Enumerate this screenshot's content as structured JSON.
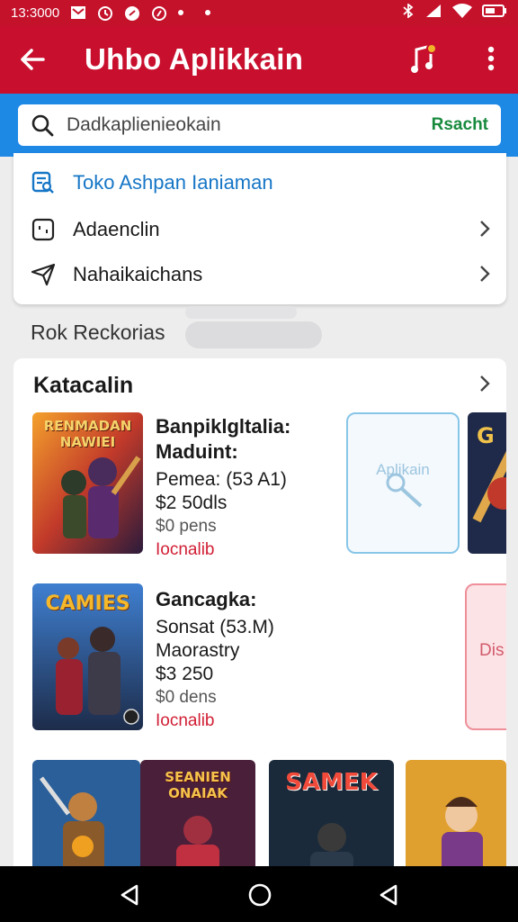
{
  "status_bar": {
    "time": "13:3000",
    "icons": [
      "mail-icon",
      "clock-icon",
      "message-icon",
      "data-icon",
      "dot-icon",
      "bluetooth-icon",
      "signal-icon",
      "wifi-icon",
      "battery-icon"
    ]
  },
  "app_bar": {
    "title": "Uhbo Aplikkain",
    "icons": [
      "back-arrow-icon",
      "music-note-icon",
      "more-vert-icon"
    ],
    "accent": "#c8102e"
  },
  "search": {
    "placeholder": "Dadkaplienieokain",
    "action_label": "Rsacht",
    "band_color": "#1e88e5"
  },
  "menu": {
    "items": [
      {
        "label": "Toko Ashpan Ianiaman",
        "icon": "store-search-icon"
      },
      {
        "label": "Adaencl­in",
        "icon": "square-frame-icon"
      },
      {
        "label": "Nahaikaichans",
        "icon": "send-icon"
      }
    ]
  },
  "section": {
    "label": "Rok Reckorias"
  },
  "card": {
    "title": "Katacalin",
    "apps": [
      {
        "name_line1": "Banpiklgltalia:",
        "name_line2": "Maduint:",
        "size": "Pemea: (53 A1)",
        "price": "$2 50dls",
        "downloads": "$0 pens",
        "status": "Iocnalib",
        "thumb_label": "RENMADAN NAWIEI"
      },
      {
        "name_line1": "Gancagka:",
        "size": "Sonsat (53.M)",
        "developer": "Maorastry",
        "price": "$3 250",
        "downloads": "$0 dens",
        "status": "Iocnalib",
        "thumb_label": "CAMIES"
      }
    ],
    "side_blue_label": "Aplikain",
    "side_pink_label": "Dis",
    "bottom_thumbs": [
      {
        "label": ""
      },
      {
        "label": "SEANIEN ONAIAK"
      },
      {
        "label": "SAMEK"
      },
      {
        "label": ""
      }
    ]
  },
  "nav": {
    "icons": [
      "back-triangle-icon",
      "home-circle-icon",
      "recents-icon"
    ]
  }
}
